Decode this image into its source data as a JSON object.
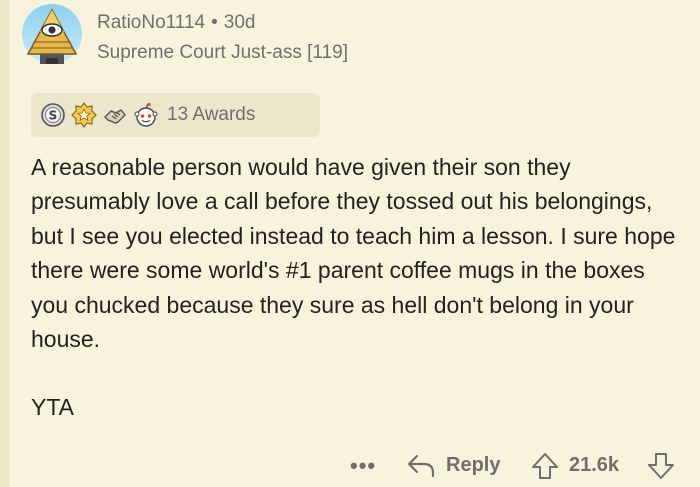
{
  "comment": {
    "username": "RatioNo1114",
    "separator": "•",
    "age": "30d",
    "flair": "Supreme Court Just-ass [119]",
    "awards": {
      "icons": [
        "silver-award-icon",
        "gold-badge-award-icon",
        "handshake-award-icon",
        "snoo-face-award-icon"
      ],
      "count_label": "13 Awards"
    },
    "body": "A reasonable person would have given their son they presumably love a call before they tossed out his belongings, but I see you elected instead to teach him a lesson. I sure hope there were some world's #1 parent coffee mugs in the boxes you chucked because they sure as hell don't belong in your house.",
    "verdict": "YTA"
  },
  "actions": {
    "more_label": "•••",
    "reply_label": "Reply",
    "score": "21.6k"
  },
  "colors": {
    "background": "#f8f4dc",
    "meta_text": "#6f6f6f",
    "body_text": "#222222",
    "awards_bg": "#ebe6cc"
  }
}
